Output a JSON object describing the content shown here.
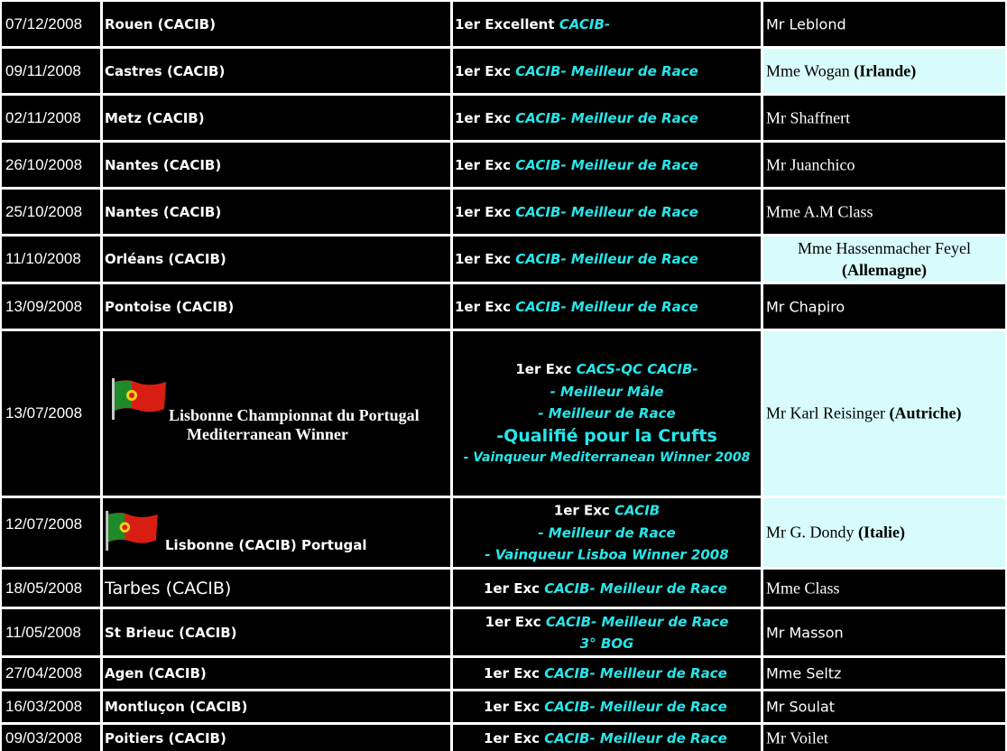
{
  "rows": [
    {
      "date": "07/12/2008",
      "show": "Rouen (CACIB)",
      "result_prefix": "1er Excellent ",
      "result_highlight": "CACIB-",
      "judge_name": "Mr Leblond"
    },
    {
      "date": "09/11/2008",
      "show": "Castres (CACIB)",
      "result_prefix": "1er Exc ",
      "result_highlight": "CACIB- Meilleur de Race",
      "judge_name": "Mme Wogan ",
      "judge_country": "(Irlande)"
    },
    {
      "date": "02/11/2008",
      "show": "Metz (CACIB)",
      "result_prefix": "1er Exc ",
      "result_highlight": "CACIB- Meilleur de Race",
      "judge_name": "Mr Shaffnert"
    },
    {
      "date": "26/10/2008",
      "show": "Nantes (CACIB)",
      "result_prefix": "1er Exc ",
      "result_highlight": "CACIB- Meilleur de Race",
      "judge_name": "Mr Juanchico"
    },
    {
      "date": "25/10/2008",
      "show": "Nantes (CACIB)",
      "result_prefix": "1er Exc ",
      "result_highlight": "CACIB- Meilleur de Race",
      "judge_name": "Mme A.M Class"
    },
    {
      "date": "11/10/2008",
      "show": "Orléans (CACIB)",
      "result_prefix": "1er Exc ",
      "result_highlight": "CACIB- Meilleur de Race",
      "judge_name": "Mme Hassenmacher Feyel",
      "judge_country": "(Allemagne)"
    },
    {
      "date": "13/09/2008",
      "show": "Pontoise (CACIB)",
      "result_prefix": "1er Exc ",
      "result_highlight": "CACIB- Meilleur de Race",
      "judge_name": "Mr Chapiro"
    },
    {
      "date": "13/07/2008",
      "show_line1": "Lisbonne Championnat du Portugal",
      "show_line2": "Mediterranean Winner",
      "result_line1_prefix": "1er Exc ",
      "result_line1_highlight": "CACS-QC CACIB-",
      "result_line2": "- Meilleur Mâle",
      "result_line3": "- Meilleur de Race",
      "result_line4": "-Qualifié pour la Crufts",
      "result_line5": "- Vainqueur Mediterranean Winner 2008",
      "judge_name": "Mr Karl Reisinger ",
      "judge_country": "(Autriche)"
    },
    {
      "date": "12/07/2008",
      "show": "Lisbonne (CACIB) Portugal",
      "result_line1_prefix": "1er Exc ",
      "result_line1_highlight": "CACIB",
      "result_line2": "- Meilleur de Race",
      "result_line3": "- Vainqueur Lisboa Winner 2008",
      "judge_name": "Mr G. Dondy ",
      "judge_country": "(Italie)"
    },
    {
      "date": "18/05/2008",
      "show": "Tarbes (CACIB)",
      "result_prefix": "1er Exc ",
      "result_highlight": "CACIB- Meilleur de Race",
      "judge_name": "Mme Class"
    },
    {
      "date": "11/05/2008",
      "show": "St Brieuc (CACIB)",
      "result_line1_prefix": "1er Exc ",
      "result_line1_highlight": "CACIB- Meilleur de Race",
      "result_line2": "3° BOG",
      "judge_name": "Mr Masson"
    },
    {
      "date": "27/04/2008",
      "show": "Agen (CACIB)",
      "result_prefix": "1er Exc ",
      "result_highlight": "CACIB- Meilleur de Race",
      "judge_name": "Mme Seltz"
    },
    {
      "date": "16/03/2008",
      "show": "Montluçon (CACIB)",
      "result_prefix": "1er Exc ",
      "result_highlight": "CACIB- Meilleur de Race",
      "judge_name": "Mr Soulat"
    },
    {
      "date": "09/03/2008",
      "show": "Poitiers (CACIB)",
      "result_prefix": "1er Exc ",
      "result_highlight": "CACIB- Meilleur de Race",
      "judge_name": "Mr Voilet"
    }
  ],
  "flags": {
    "icon": "portugal-flag-icon",
    "green": "#1f8a2a",
    "red": "#d81e12"
  },
  "colors": {
    "background": "#000000",
    "highlight_text": "#27e6ea",
    "judge_cell": "#d8fbfb",
    "grid": "#ffffff"
  }
}
